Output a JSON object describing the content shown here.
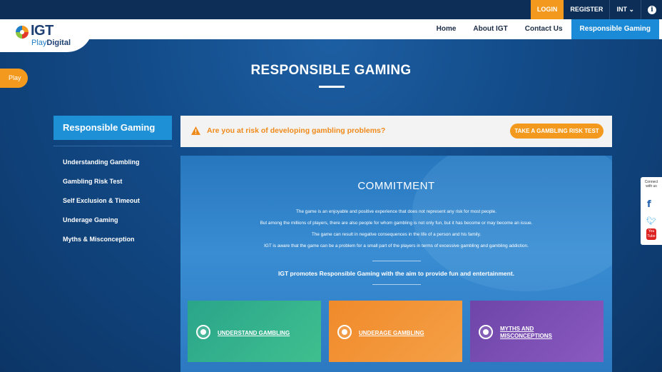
{
  "utility": {
    "login": "LOGIN",
    "register": "REGISTER",
    "language": "INT",
    "info_icon": "info-icon"
  },
  "brand": {
    "name": "IGT",
    "sub_light": "Play",
    "sub_bold": "Digital"
  },
  "nav": {
    "items": [
      "Home",
      "About IGT",
      "Contact Us",
      "Responsible Gaming"
    ],
    "active": "Responsible Gaming"
  },
  "side_tab": {
    "label": "Play"
  },
  "page": {
    "title": "RESPONSIBLE GAMING"
  },
  "sidebar": {
    "heading": "Responsible Gaming",
    "items": [
      "Understanding Gambling",
      "Gambling Risk Test",
      "Self Exclusion & Timeout",
      "Underage Gaming",
      "Myths & Misconception"
    ]
  },
  "alert": {
    "text": "Are you at risk of developing gambling problems?",
    "button": "TAKE A GAMBLING RISK TEST"
  },
  "commitment": {
    "title": "COMMITMENT",
    "lines": [
      "The game is an enjoyable and positive experience that does not represent any risk for most people.",
      "But among the millions of players, there are also people for whom gambling is not only fun, but it has become or may become an issue.",
      "The game can result in negative consequences in the life of a person and his family.",
      "IGT is aware that the game can be a problem for a small part of the players in terms of excessive gambling and gambling addiction."
    ],
    "promo": "IGT promotes Responsible Gaming with the aim to provide fun and entertainment."
  },
  "cards": [
    {
      "label": "UNDERSTAND GAMBLING",
      "color": "#2aa58a"
    },
    {
      "label_line1": "UNDERAGE GAMBLING",
      "color": "#f08a2a"
    },
    {
      "label_line1": "MYTHS AND",
      "label_line2": "MISCONCEPTIONS",
      "color": "#6e45a8"
    }
  ],
  "connect": {
    "label_line1": "Connect",
    "label_line2": "with us",
    "icons": [
      "facebook-icon",
      "twitter-icon",
      "youtube-icon"
    ],
    "youtube_text_top": "You",
    "youtube_text_bottom": "Tube"
  },
  "colors": {
    "accent_orange": "#f39a1e",
    "accent_blue": "#1c8bd7",
    "navy": "#0d2f57"
  }
}
